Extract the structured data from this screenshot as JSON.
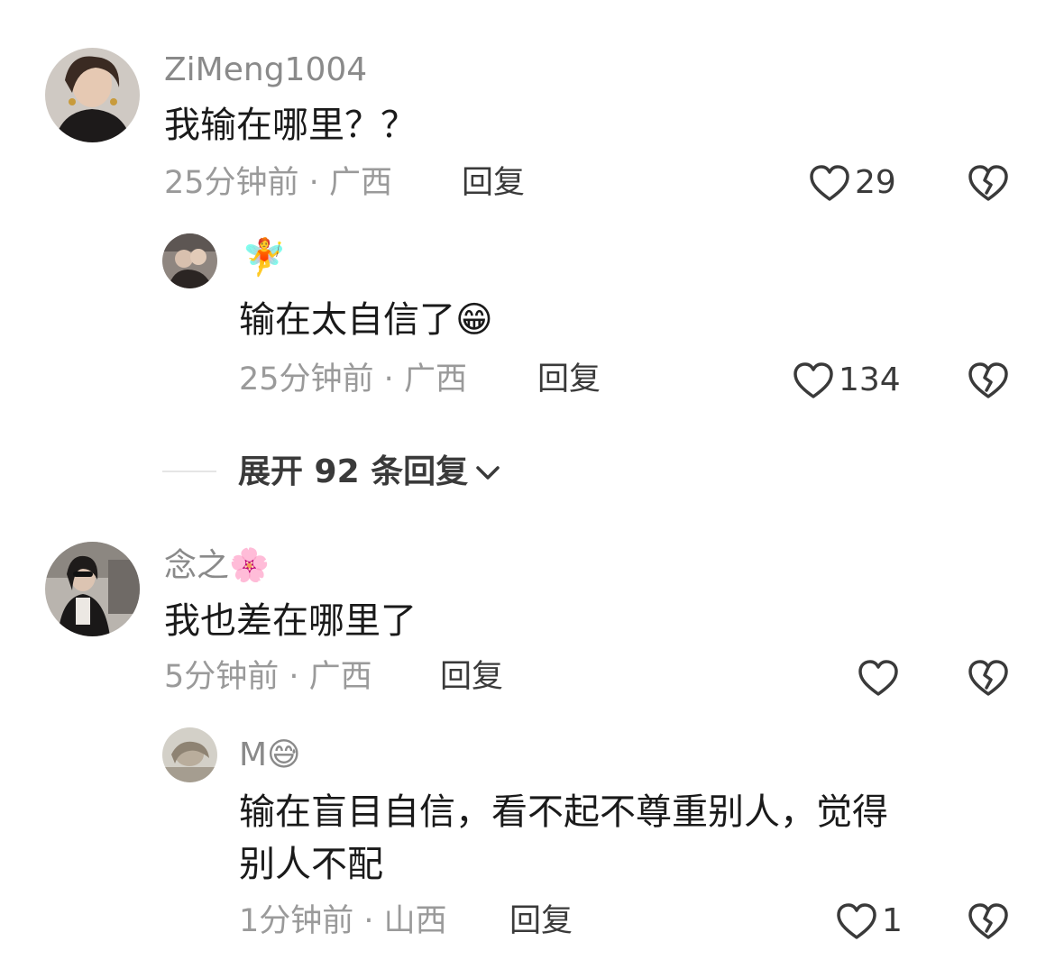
{
  "comments": [
    {
      "username": "ZiMeng1004",
      "text": "我输在哪里？？",
      "time": "25分钟前",
      "location": "广西",
      "reply_label": "回复",
      "likes": "29"
    },
    {
      "username": "🧚",
      "text": "输在太自信了😁",
      "time": "25分钟前",
      "location": "广西",
      "reply_label": "回复",
      "likes": "134"
    },
    {
      "username": "念之🌸",
      "text": "我也差在哪里了",
      "time": "5分钟前",
      "location": "广西",
      "reply_label": "回复",
      "likes": ""
    },
    {
      "username": "M😅",
      "text_line1": "输在盲目自信，看不起不尊重别人，觉得",
      "text_line2": "别人不配",
      "time": "1分钟前",
      "location": "山西",
      "reply_label": "回复",
      "likes": "1"
    }
  ],
  "expand": {
    "label": "展开 92 条回复"
  },
  "icons": {
    "like": "heart-outline-icon",
    "dislike": "broken-heart-icon",
    "expand": "chevron-down-icon"
  },
  "colors": {
    "username": "#8a8a8a",
    "text": "#1a1a1a",
    "meta": "#9a9a9a"
  }
}
